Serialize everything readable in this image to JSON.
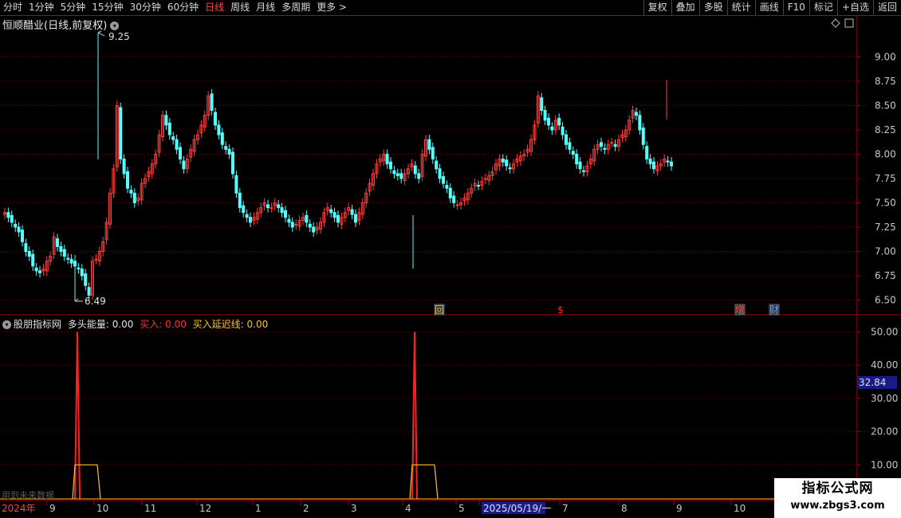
{
  "toolbar": {
    "periods": [
      {
        "label": "分时",
        "active": false
      },
      {
        "label": "1分钟",
        "active": false
      },
      {
        "label": "5分钟",
        "active": false
      },
      {
        "label": "15分钟",
        "active": false
      },
      {
        "label": "30分钟",
        "active": false
      },
      {
        "label": "60分钟",
        "active": false
      },
      {
        "label": "日线",
        "active": true
      },
      {
        "label": "周线",
        "active": false
      },
      {
        "label": "月线",
        "active": false
      },
      {
        "label": "多周期",
        "active": false
      },
      {
        "label": "更多 >",
        "active": false
      }
    ],
    "right_buttons": [
      "复权",
      "叠加",
      "多股",
      "统计",
      "画线",
      "F10",
      "标记",
      "+自选",
      "返回"
    ]
  },
  "stock": {
    "title": "恒顺醋业(日线,前复权)"
  },
  "price_axis": {
    "ticks": [
      "9.00",
      "8.75",
      "8.50",
      "8.25",
      "8.00",
      "7.75",
      "7.50",
      "7.25",
      "7.00",
      "6.75",
      "6.50"
    ]
  },
  "price_labels": {
    "high": "9.25",
    "low": "6.49"
  },
  "event_markers": [
    {
      "label": "回",
      "color": "#e0c060"
    },
    {
      "label": "$",
      "color": "#ff3030"
    },
    {
      "label": "增",
      "color": "#ff5050"
    },
    {
      "label": "财",
      "color": "#60a0ff"
    }
  ],
  "indicator": {
    "name": "股朋指标网",
    "line1_label": "多头能量: 0.00",
    "line2_label": "买入: 0.00",
    "line3_label": "买入延迟线: 0.00",
    "axis_ticks": [
      "50.00",
      "40.00",
      "30.00",
      "20.00",
      "10.00"
    ],
    "current_value": "32.84",
    "future_note": "用到未来数据"
  },
  "date_axis": {
    "labels": [
      "2024年",
      "9",
      "10",
      "11",
      "12",
      "1",
      "2",
      "3",
      "4",
      "5",
      "2025/05/19/一",
      "7",
      "8",
      "9",
      "10"
    ]
  },
  "watermark": {
    "line1": "指标公式网",
    "line2": "www.zbgs3.com"
  },
  "colors": {
    "up": "#ff3c3c",
    "down": "#54ffff",
    "grid": "#5a0000",
    "axis": "#b00000",
    "buy": "#ff2020",
    "delay": "#ffc030"
  }
}
